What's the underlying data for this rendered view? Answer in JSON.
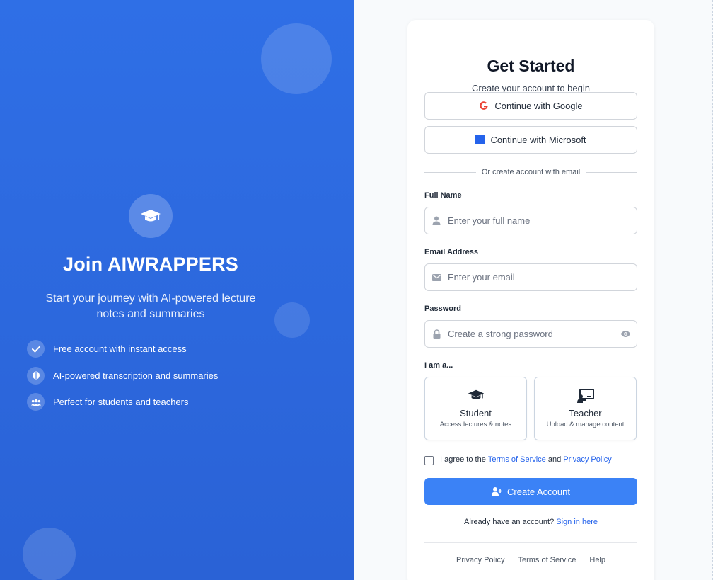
{
  "brand": {
    "title": "Join AIWRAPPERS",
    "subtitle": "Start your journey with AI-powered lecture notes and summaries",
    "icon": "graduation-cap-icon",
    "features": [
      {
        "icon": "check-icon",
        "label": "Free account with instant access"
      },
      {
        "icon": "brain-icon",
        "label": "AI-powered transcription and summaries"
      },
      {
        "icon": "users-icon",
        "label": "Perfect for students and teachers"
      }
    ]
  },
  "form": {
    "title": "Get Started",
    "subtitle": "Create your account to begin",
    "google_label": "Continue with Google",
    "microsoft_label": "Continue with Microsoft",
    "divider": "Or create account with email",
    "full_name": {
      "label": "Full Name",
      "placeholder": "Enter your full name",
      "icon": "user-icon"
    },
    "email": {
      "label": "Email Address",
      "placeholder": "Enter your email",
      "icon": "envelope-icon"
    },
    "password": {
      "label": "Password",
      "placeholder": "Create a strong password",
      "icon": "lock-icon",
      "toggle_icon": "eye-icon"
    },
    "role_label": "I am a...",
    "roles": [
      {
        "title": "Student",
        "description": "Access lectures & notes",
        "icon": "graduation-cap-icon"
      },
      {
        "title": "Teacher",
        "description": "Upload & manage content",
        "icon": "chalkboard-teacher-icon"
      }
    ],
    "agree_prefix": "I agree to the",
    "terms_link": "Terms of Service",
    "agree_and": "and",
    "privacy_link": "Privacy Policy",
    "submit": "Create Account",
    "signin_prompt": "Already have an account?",
    "signin_link": "Sign in here"
  },
  "footer": {
    "links": [
      "Privacy Policy",
      "Terms of Service",
      "Help"
    ]
  },
  "colors": {
    "brand_blue": "#2f6fe6",
    "primary_button": "#3b82f6",
    "link": "#2563eb",
    "google_red": "#ea4335",
    "microsoft_blue": "#2563eb"
  }
}
